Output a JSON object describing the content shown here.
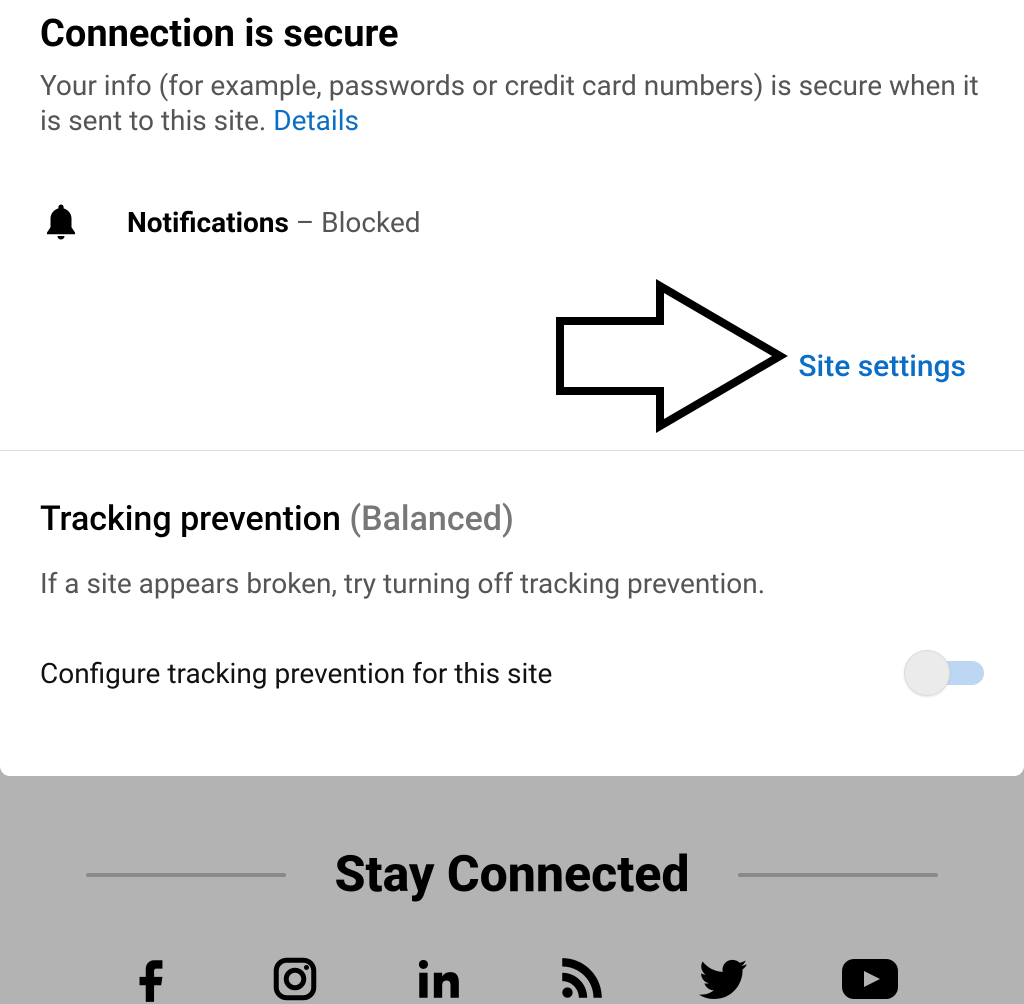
{
  "connection": {
    "title": "Connection is secure",
    "description_prefix": "Your info (for example, passwords or credit card numbers) is secure when it is sent to this site. ",
    "details_link": "Details"
  },
  "notifications": {
    "label": "Notifications",
    "separator": " – ",
    "status": "Blocked"
  },
  "site_settings": {
    "link": "Site settings"
  },
  "tracking": {
    "title": "Tracking prevention",
    "mode": "(Balanced)",
    "description": "If a site appears broken, try turning off tracking prevention.",
    "toggle_label": "Configure tracking prevention for this site",
    "toggle_on": false
  },
  "footer": {
    "stay_connected": "Stay Connected",
    "social": [
      "facebook",
      "instagram",
      "linkedin",
      "rss",
      "twitter",
      "youtube"
    ]
  },
  "colors": {
    "link": "#0a6ec7",
    "text_muted": "#555",
    "toggle_track": "#bcd6f4"
  }
}
